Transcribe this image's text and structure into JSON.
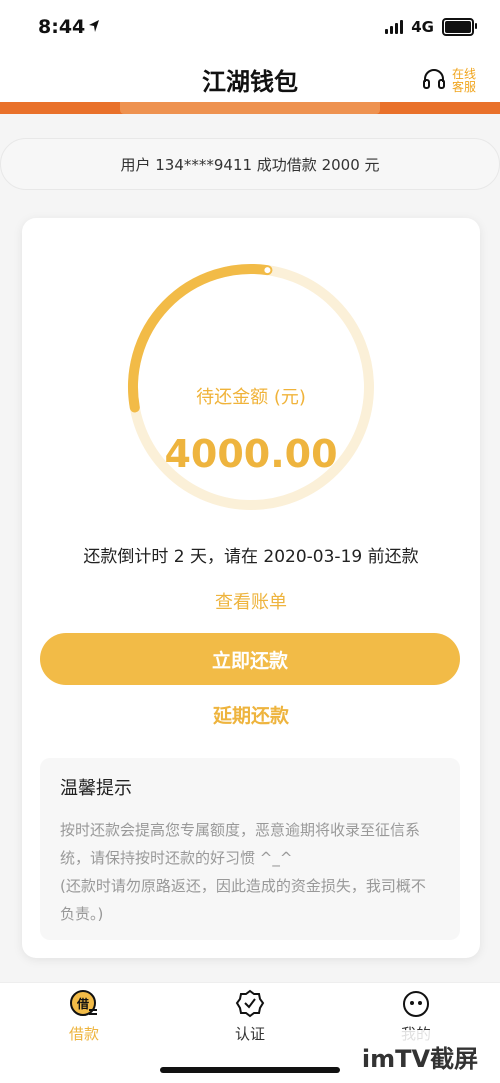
{
  "status": {
    "time": "8:44",
    "network": "4G"
  },
  "header": {
    "title": "江湖钱包",
    "service_label": "在线客服"
  },
  "notice": {
    "text": "用户 134****9411 成功借款 2000 元"
  },
  "repayment": {
    "ring_label": "待还金额 (元)",
    "amount": "4000.00",
    "progress_fraction": 0.3,
    "countdown": "还款倒计时 2 天，请在 2020-03-19 前还款",
    "view_bill": "查看账单",
    "repay_now": "立即还款",
    "extend": "延期还款"
  },
  "tips": {
    "title": "温馨提示",
    "line1": "按时还款会提高您专属额度，恶意逾期将收录至征信系统，请保持按时还款的好习惯 ^_^",
    "line2": "(还款时请勿原路返还，因此造成的资金损失，我司概不负责。)"
  },
  "tabs": [
    {
      "label": "借款",
      "icon_text": "借"
    },
    {
      "label": "认证"
    },
    {
      "label": "我的"
    }
  ],
  "watermark": {
    "text": "imTV截屏"
  },
  "colors": {
    "accent": "#f2bb47",
    "orange": "#e9712a",
    "ring_track": "#fbf0d8"
  }
}
